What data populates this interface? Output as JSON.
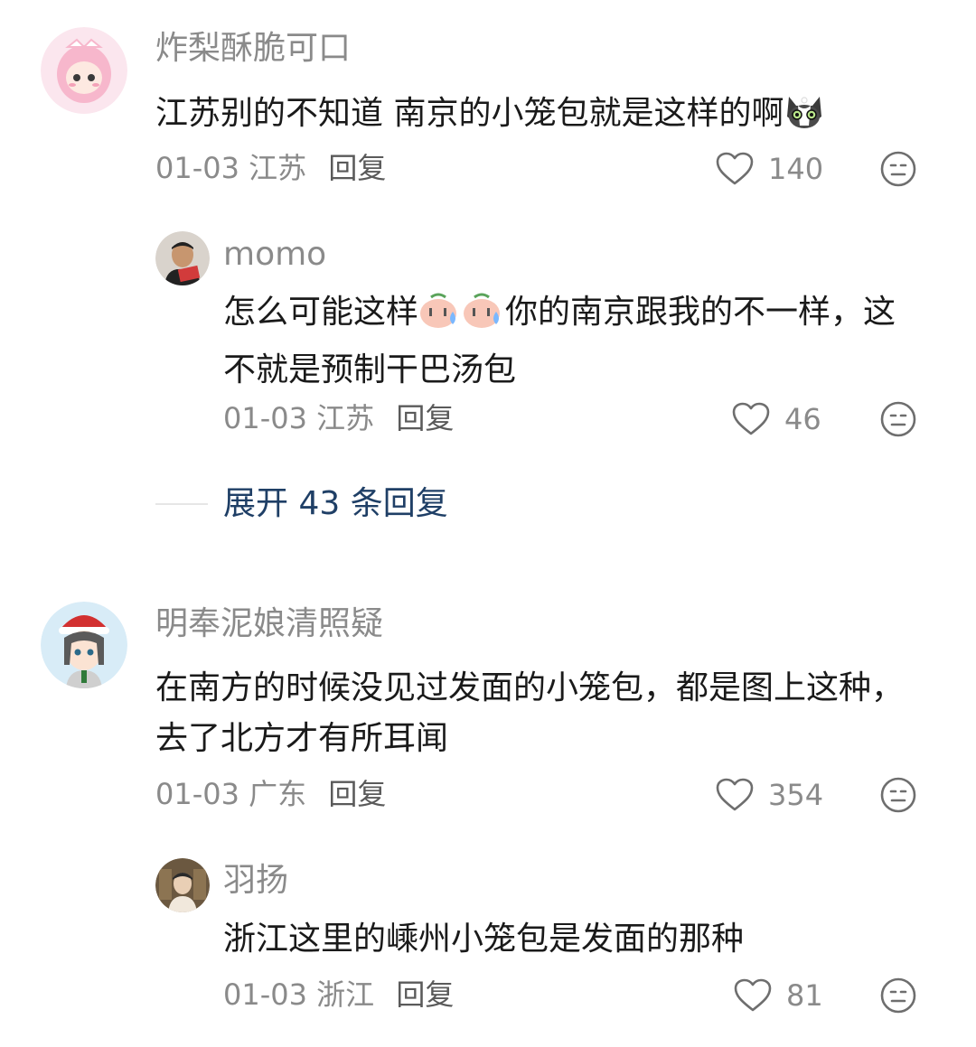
{
  "comments": [
    {
      "username": "炸梨酥脆可口",
      "text_before_emoji": "江苏别的不知道 南京的小笼包就是这样的啊",
      "emoji": "cat-face",
      "date": "01-03",
      "location": "江苏",
      "reply_label": "回复",
      "likes": "140",
      "replies": [
        {
          "username": "momo",
          "text_part1": "怎么可能这样",
          "emoji": "bun-sweat",
          "text_part2": "你的南京跟我的不一样，这不就是预制干巴汤包",
          "date": "01-03",
          "location": "江苏",
          "reply_label": "回复",
          "likes": "46"
        }
      ],
      "expand_label": "展开 43 条回复"
    },
    {
      "username": "明奉泥娘清照疑",
      "text": "在南方的时候没见过发面的小笼包，都是图上这种，去了北方才有所耳闻",
      "date": "01-03",
      "location": "广东",
      "reply_label": "回复",
      "likes": "354",
      "replies": [
        {
          "username": "羽扬",
          "text": "浙江这里的嵊州小笼包是发面的那种",
          "date": "01-03",
          "location": "浙江",
          "reply_label": "回复",
          "likes": "81"
        }
      ]
    }
  ],
  "icons": {
    "like": "heart-outline-icon",
    "react": "neutral-face-icon"
  },
  "colors": {
    "username": "#8a8a8a",
    "text": "#1a1a1a",
    "link": "#1f3f66"
  }
}
